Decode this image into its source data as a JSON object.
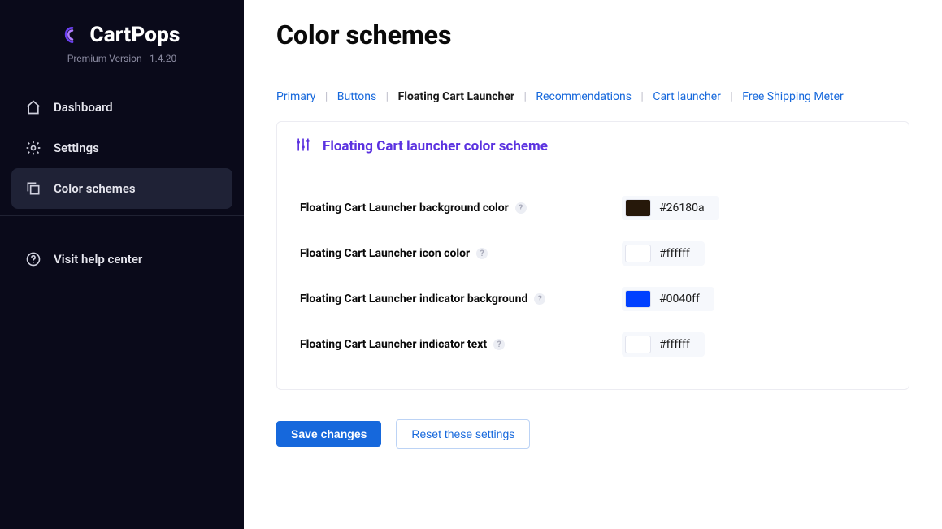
{
  "brand": {
    "name": "CartPops",
    "subtitle": "Premium Version - 1.4.20"
  },
  "sidebar": {
    "items": [
      {
        "label": "Dashboard",
        "icon": "home-icon"
      },
      {
        "label": "Settings",
        "icon": "gear-icon"
      },
      {
        "label": "Color schemes",
        "icon": "copy-icon"
      }
    ],
    "help_label": "Visit help center"
  },
  "page": {
    "title": "Color schemes"
  },
  "tabs": [
    {
      "label": "Primary"
    },
    {
      "label": "Buttons"
    },
    {
      "label": "Floating Cart Launcher",
      "active": true
    },
    {
      "label": "Recommendations"
    },
    {
      "label": "Cart launcher"
    },
    {
      "label": "Free Shipping Meter"
    }
  ],
  "panel": {
    "title": "Floating Cart launcher color scheme",
    "fields": [
      {
        "label": "Floating Cart Launcher background color",
        "value": "#26180a",
        "swatch": "#26180a"
      },
      {
        "label": "Floating Cart Launcher icon color",
        "value": "#ffffff",
        "swatch": "#ffffff"
      },
      {
        "label": "Floating Cart Launcher indicator background",
        "value": "#0040ff",
        "swatch": "#0040ff"
      },
      {
        "label": "Floating Cart Launcher indicator text",
        "value": "#ffffff",
        "swatch": "#ffffff"
      }
    ]
  },
  "actions": {
    "save": "Save changes",
    "reset": "Reset these settings"
  },
  "colors": {
    "accent": "#5b32e0",
    "link": "#1668dc"
  }
}
